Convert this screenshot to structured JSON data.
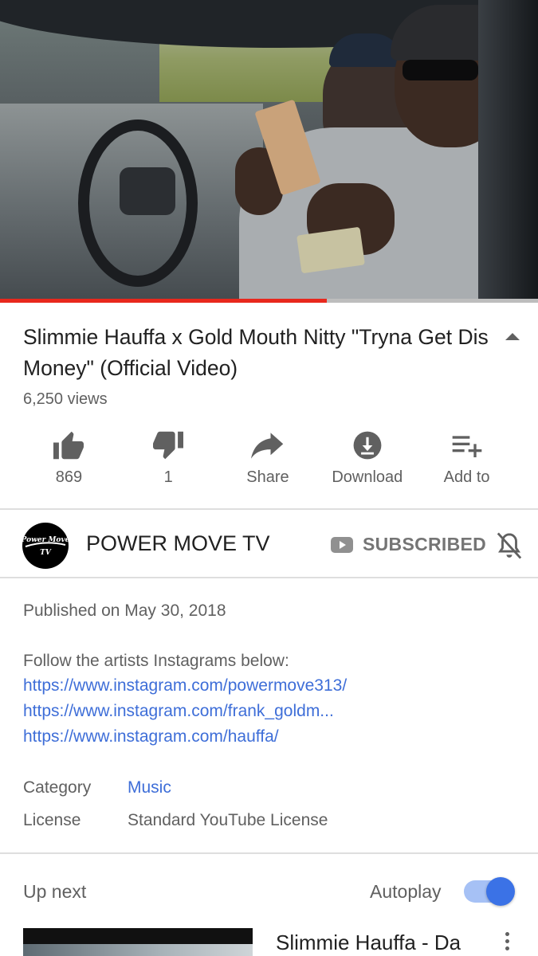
{
  "video": {
    "progress_fraction": 0.607
  },
  "title": "Slimmie Hauffa x Gold Mouth Nitty \"Tryna Get Dis Money\" (Official Video)",
  "views": "6,250 views",
  "actions": {
    "like": "869",
    "dislike": "1",
    "share": "Share",
    "download": "Download",
    "add_to": "Add to"
  },
  "channel": {
    "avatar_text": "Power Move TV",
    "name": "POWER MOVE TV",
    "subscribe_label": "SUBSCRIBED"
  },
  "description": {
    "published": "Published on May 30, 2018",
    "intro": "Follow the artists Instagrams below:",
    "links": [
      "https://www.instagram.com/powermove313/",
      "https://www.instagram.com/frank_goldm...",
      "https://www.instagram.com/hauffa/"
    ],
    "category_label": "Category",
    "category_value": "Music",
    "license_label": "License",
    "license_value": "Standard YouTube License"
  },
  "up_next": {
    "heading": "Up next",
    "autoplay_label": "Autoplay",
    "autoplay_on": true,
    "next_title": "Slimmie Hauffa - Da"
  },
  "colors": {
    "progress": "#e8281d",
    "link": "#3e6ed8",
    "toggle_knob": "#3b72e6",
    "toggle_track": "#a6c1f5"
  },
  "icons": [
    "thumbs-up-icon",
    "thumbs-down-icon",
    "share-icon",
    "download-icon",
    "playlist-add-icon",
    "collapse-icon",
    "youtube-icon",
    "bell-off-icon",
    "more-vert-icon"
  ]
}
